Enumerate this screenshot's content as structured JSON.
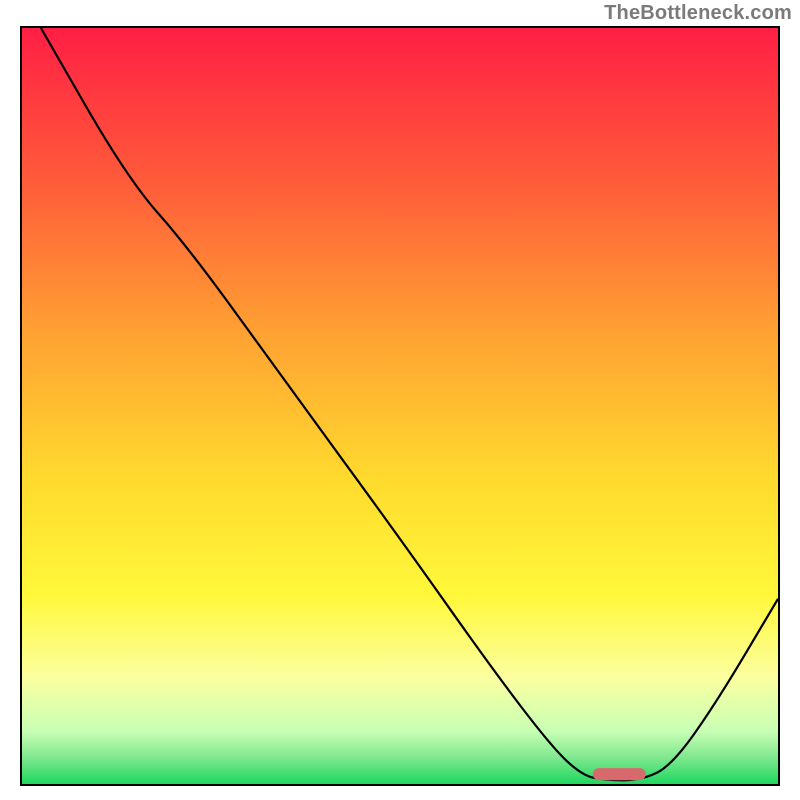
{
  "watermark": "TheBottleneck.com",
  "chart_data": {
    "type": "line",
    "title": "",
    "xlabel": "",
    "ylabel": "",
    "xlim": [
      0,
      100
    ],
    "ylim": [
      0,
      100
    ],
    "grid": false,
    "legend": false,
    "background_gradient": {
      "type": "vertical",
      "stops": [
        {
          "offset": 0.0,
          "color": "#ff1f44"
        },
        {
          "offset": 0.2,
          "color": "#ff5a3a"
        },
        {
          "offset": 0.4,
          "color": "#ffa033"
        },
        {
          "offset": 0.6,
          "color": "#ffdb2e"
        },
        {
          "offset": 0.75,
          "color": "#fff83a"
        },
        {
          "offset": 0.86,
          "color": "#fbffa0"
        },
        {
          "offset": 0.93,
          "color": "#c8ffb4"
        },
        {
          "offset": 0.965,
          "color": "#7fe88f"
        },
        {
          "offset": 1.0,
          "color": "#1ed75f"
        }
      ]
    },
    "series": [
      {
        "name": "bottleneck-curve",
        "points": [
          {
            "x": 2.5,
            "y": 100.0
          },
          {
            "x": 14.0,
            "y": 80.0
          },
          {
            "x": 22.0,
            "y": 71.0
          },
          {
            "x": 35.0,
            "y": 53.0
          },
          {
            "x": 50.0,
            "y": 32.5
          },
          {
            "x": 62.0,
            "y": 15.5
          },
          {
            "x": 70.0,
            "y": 5.0
          },
          {
            "x": 74.0,
            "y": 1.2
          },
          {
            "x": 77.0,
            "y": 0.5
          },
          {
            "x": 82.0,
            "y": 0.5
          },
          {
            "x": 86.0,
            "y": 2.5
          },
          {
            "x": 92.0,
            "y": 11.0
          },
          {
            "x": 100.0,
            "y": 24.5
          }
        ]
      }
    ],
    "annotations": [
      {
        "name": "optimal-marker",
        "shape": "rounded-rect",
        "x_center": 79.0,
        "y_center": 1.3,
        "width": 7.0,
        "height": 1.6,
        "color": "#d86a6e"
      }
    ]
  }
}
